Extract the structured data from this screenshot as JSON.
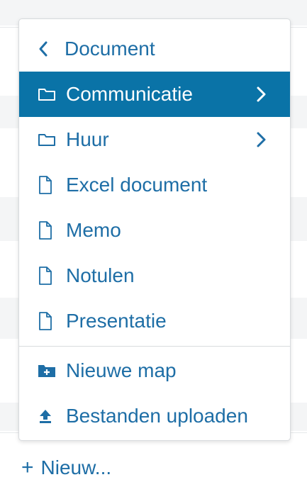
{
  "menu": {
    "back_label": "Document",
    "folders": [
      {
        "label": "Communicatie"
      },
      {
        "label": "Huur"
      }
    ],
    "templates": [
      {
        "label": "Excel document"
      },
      {
        "label": "Memo"
      },
      {
        "label": "Notulen"
      },
      {
        "label": "Presentatie"
      }
    ],
    "actions": {
      "new_folder": "Nieuwe map",
      "upload": "Bestanden uploaden"
    }
  },
  "new_button_label": "Nieuw...",
  "colors": {
    "accent": "#1e6ea6",
    "active_bg": "#0a73a7"
  }
}
